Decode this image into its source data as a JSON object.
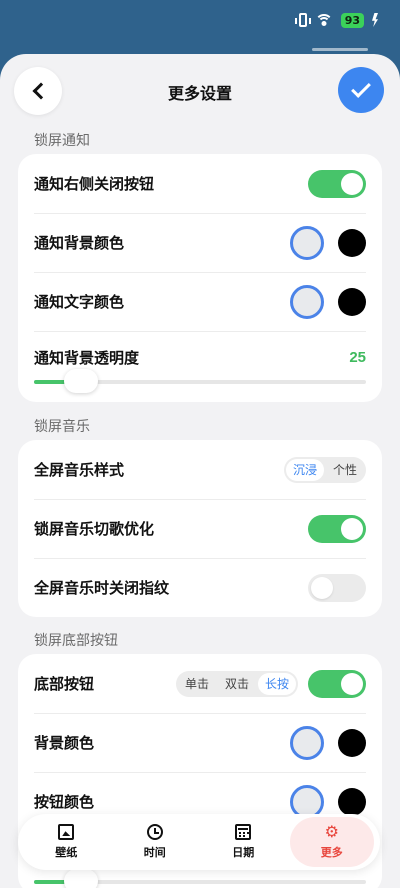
{
  "status_bar": {
    "battery": "93"
  },
  "header": {
    "title": "更多设置"
  },
  "sections": {
    "notification": {
      "title": "锁屏通知",
      "close_button_label": "通知右侧关闭按钮",
      "close_button_on": true,
      "bg_color_label": "通知背景颜色",
      "text_color_label": "通知文字颜色",
      "opacity_label": "通知背景透明度",
      "opacity_value": "25"
    },
    "music": {
      "title": "锁屏音乐",
      "style_label": "全屏音乐样式",
      "style_options": [
        "沉浸",
        "个性"
      ],
      "style_selected": "沉浸",
      "skip_label": "锁屏音乐切歌优化",
      "skip_on": true,
      "fingerprint_label": "全屏音乐时关闭指纹",
      "fingerprint_on": false
    },
    "bottom_button": {
      "title": "锁屏底部按钮",
      "button_label": "底部按钮",
      "button_options": [
        "单击",
        "双击",
        "长按"
      ],
      "button_selected": "长按",
      "button_on": true,
      "bg_color_label": "背景颜色",
      "btn_color_label": "按钮颜色"
    }
  },
  "colors": {
    "accent_blue": "#3d86f0",
    "toggle_green": "#47c46a",
    "active_red": "#e8453c"
  },
  "nav": {
    "items": [
      {
        "label": "壁纸",
        "icon": "wallpaper-icon"
      },
      {
        "label": "时间",
        "icon": "clock-icon"
      },
      {
        "label": "日期",
        "icon": "calendar-icon"
      },
      {
        "label": "更多",
        "icon": "gear-icon",
        "active": true
      }
    ]
  }
}
